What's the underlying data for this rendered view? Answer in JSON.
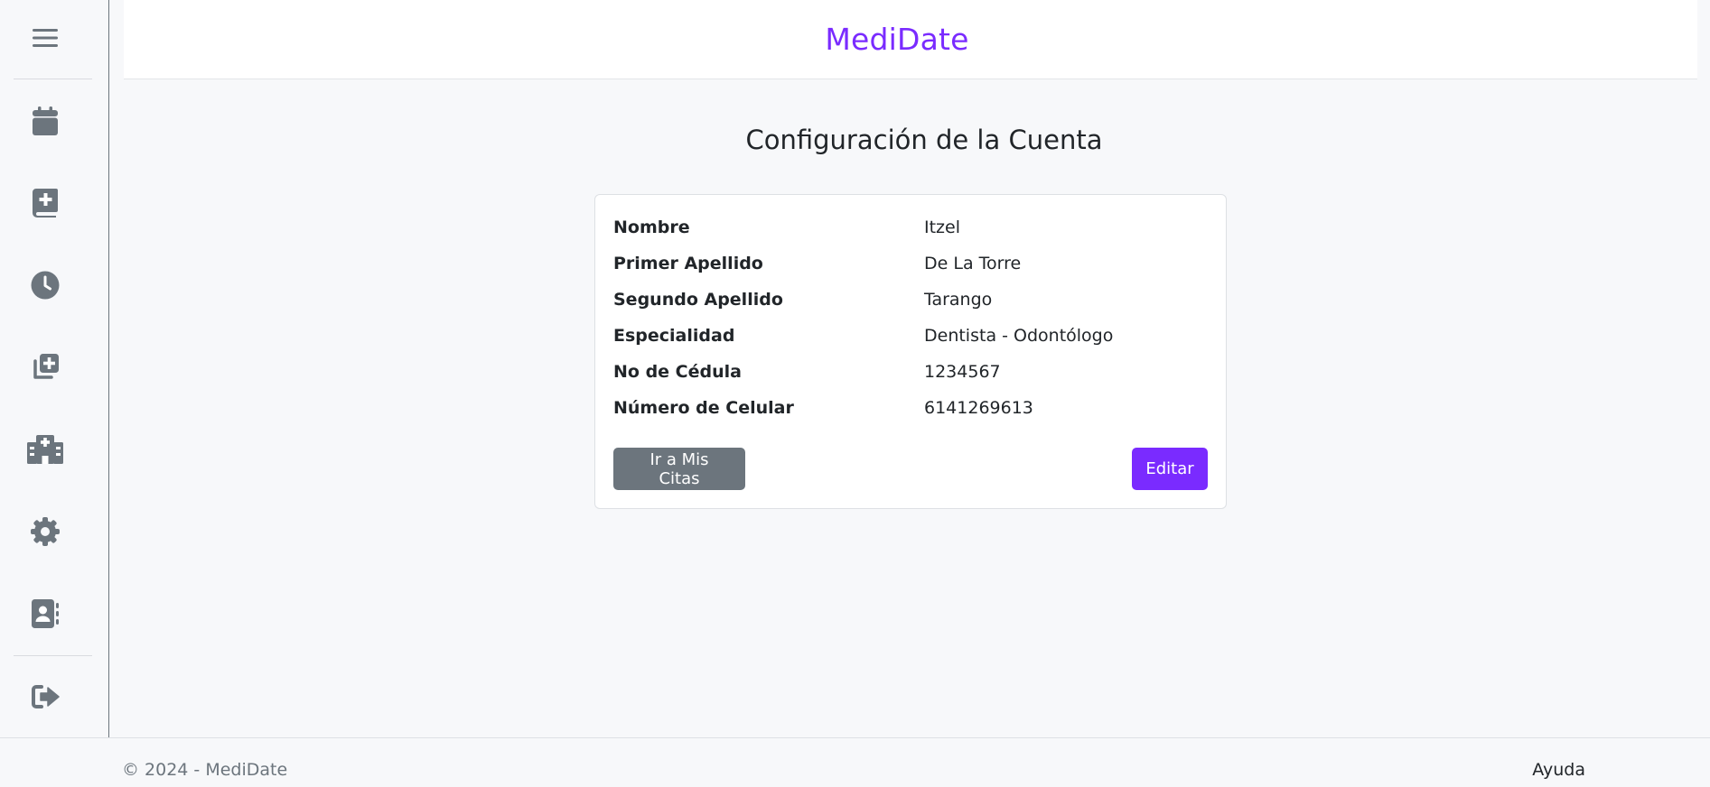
{
  "app": {
    "brand": "MediDate",
    "brand_color": "#7a2bff"
  },
  "sidebar": {
    "items": [
      {
        "name": "menu",
        "icon": "hamburger-menu-icon"
      },
      {
        "name": "calendar",
        "icon": "calendar-icon"
      },
      {
        "name": "medical-book",
        "icon": "medical-book-icon"
      },
      {
        "name": "history",
        "icon": "clock-icon"
      },
      {
        "name": "add-appointment",
        "icon": "add-copy-icon"
      },
      {
        "name": "hospital",
        "icon": "hospital-icon"
      },
      {
        "name": "settings",
        "icon": "gear-icon"
      },
      {
        "name": "contacts",
        "icon": "address-book-icon"
      },
      {
        "name": "logout",
        "icon": "sign-out-icon"
      }
    ]
  },
  "main": {
    "title": "Configuración de la Cuenta",
    "fields": [
      {
        "label": "Nombre",
        "value": "Itzel"
      },
      {
        "label": "Primer Apellido",
        "value": "De La Torre"
      },
      {
        "label": "Segundo Apellido",
        "value": "Tarango"
      },
      {
        "label": "Especialidad",
        "value": "Dentista - Odontólogo"
      },
      {
        "label": "No de Cédula",
        "value": "1234567"
      },
      {
        "label": "Número de Celular",
        "value": "6141269613"
      }
    ],
    "buttons": {
      "go_appointments": "Ir a Mis Citas",
      "edit": "Editar"
    }
  },
  "footer": {
    "copyright": "© 2024 - MediDate",
    "help": "Ayuda"
  },
  "colors": {
    "accent": "#7a2bff",
    "secondary": "#6c757d",
    "icon": "#6c757d"
  }
}
